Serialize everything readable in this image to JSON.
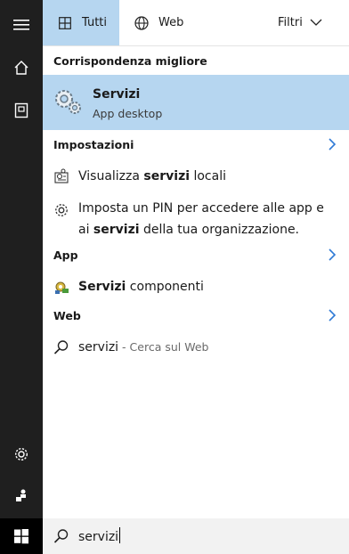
{
  "tabs": {
    "all_label": "Tutti",
    "web_label": "Web",
    "filters_label": "Filtri"
  },
  "sections": {
    "best_match": "Corrispondenza migliore",
    "settings": "Impostazioni",
    "app": "App",
    "web": "Web"
  },
  "best_match": {
    "title": "Servizi",
    "subtitle": "App desktop",
    "icon": "gears-icon"
  },
  "settings_items": [
    {
      "pre": "Visualizza ",
      "bold": "servizi",
      "post": " locali"
    },
    {
      "line1_pre": "Imposta un PIN per accedere alle app e",
      "line2_pre": "ai ",
      "line2_bold": "servizi",
      "line2_post": " della tua organizzazione."
    }
  ],
  "app_items": [
    {
      "bold": "Servizi",
      "post": " componenti"
    }
  ],
  "web_items": [
    {
      "query": "servizi",
      "suffix": " - Cerca sul Web"
    }
  ],
  "search": {
    "value": "servizi"
  },
  "colors": {
    "accent": "#b6d6f0",
    "rail": "#1f1f1f",
    "chevron": "#2f7ad6"
  }
}
